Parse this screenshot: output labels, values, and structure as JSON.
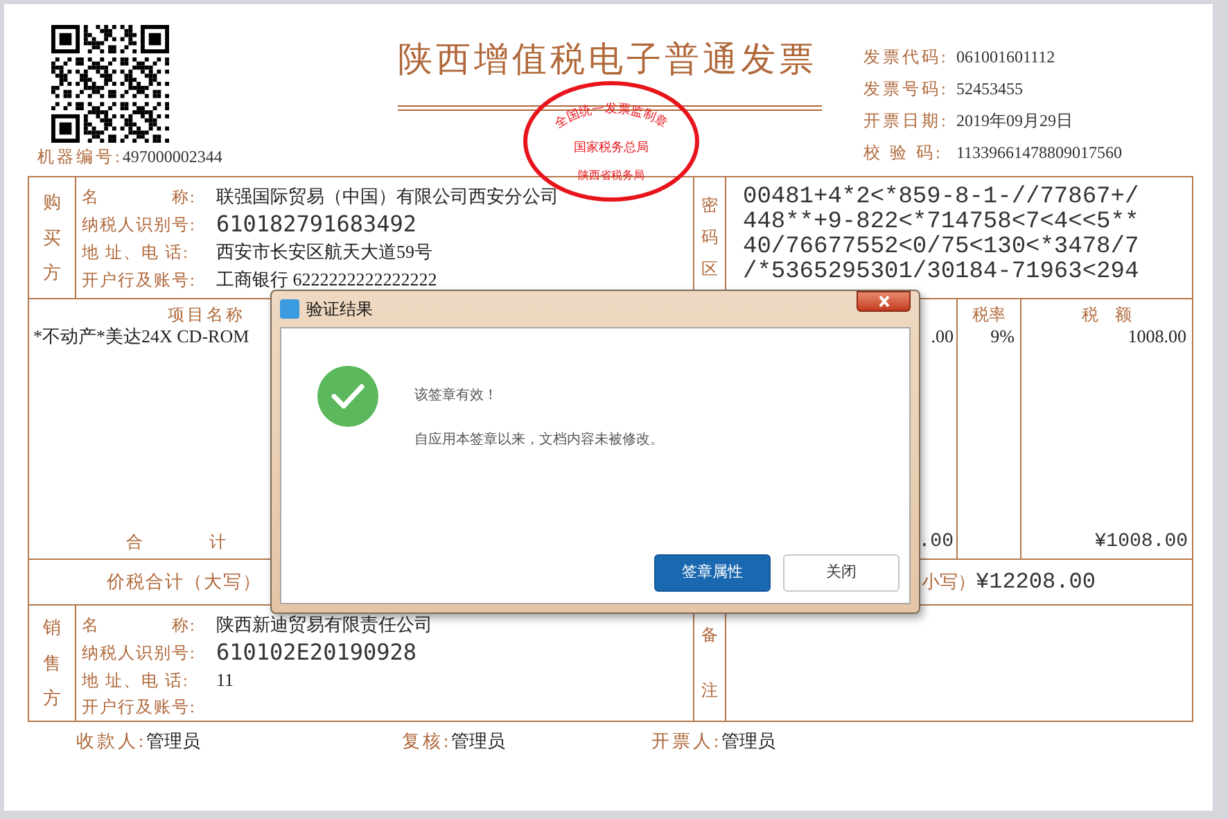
{
  "header": {
    "machine_no_label": "机器编号:",
    "machine_no": "497000002344",
    "title": "陕西增值税电子普通发票",
    "stamp": {
      "top_text": "全国统一发票监制章",
      "middle_text": "国家税务总局",
      "bottom_text": "陕西省税务局"
    },
    "fields": [
      {
        "label": "发票代码:",
        "value": "061001601112"
      },
      {
        "label": "发票号码:",
        "value": "52453455"
      },
      {
        "label": "开票日期:",
        "value": "2019年09月29日"
      },
      {
        "label": "校 验 码:",
        "value": "11339661478809017560"
      }
    ]
  },
  "buyer": {
    "side_label": "购买方",
    "fields": [
      {
        "label": "名　　　　称:",
        "value": "联强国际贸易（中国）有限公司西安分公司",
        "kind": "text"
      },
      {
        "label": "纳税人识别号:",
        "value": "610182791683492",
        "kind": "code"
      },
      {
        "label": "地 址、电 话:",
        "value": "西安市长安区航天大道59号",
        "kind": "text"
      },
      {
        "label": "开户行及账号:",
        "value": "工商银行 6222222222222222",
        "kind": "text"
      }
    ],
    "cipher_label": "密码区",
    "cipher_lines": [
      "00481+4*2<*859-8-1-//77867+/",
      "448**+9-822<*714758<7<4<<5**",
      "40/76677552<0/75<130<*3478/7",
      "/*5365295301/30184-71963<294"
    ]
  },
  "items": {
    "columns": [
      {
        "label": "项目名称"
      },
      {
        "label": "税率"
      },
      {
        "label": "税　额"
      }
    ],
    "rows": [
      {
        "name": "*不动产*美达24X CD-ROM",
        "amount": ".00",
        "tax_rate": "9%",
        "tax": "1008.00"
      }
    ],
    "total_label": "合　　　　计",
    "total_amount": ".00",
    "total_tax": "¥1008.00"
  },
  "grand_total": {
    "label": "价税合计（大写）",
    "small_label": "小写）",
    "value": "¥12208.00"
  },
  "seller": {
    "side_label": "销售方",
    "fields": [
      {
        "label": "名　　　　称:",
        "value": "陕西新迪贸易有限责任公司",
        "kind": "text"
      },
      {
        "label": "纳税人识别号:",
        "value": "610102E20190928",
        "kind": "code"
      },
      {
        "label": "地 址、电 话:",
        "value": "11",
        "kind": "text"
      },
      {
        "label": "开户行及账号:"
      }
    ],
    "remark_label": "备注"
  },
  "signatures": [
    {
      "label": "收款人:",
      "value": "管理员"
    },
    {
      "label": "复核:",
      "value": "管理员"
    },
    {
      "label": "开票人:",
      "value": "管理员"
    }
  ],
  "dialog": {
    "title": "验证结果",
    "message": "该签章有效！",
    "detail": "自应用本签章以来，文档内容未被修改。",
    "buttons": [
      {
        "label": "签章属性",
        "primary": true
      },
      {
        "label": "关闭",
        "primary": false
      }
    ]
  }
}
